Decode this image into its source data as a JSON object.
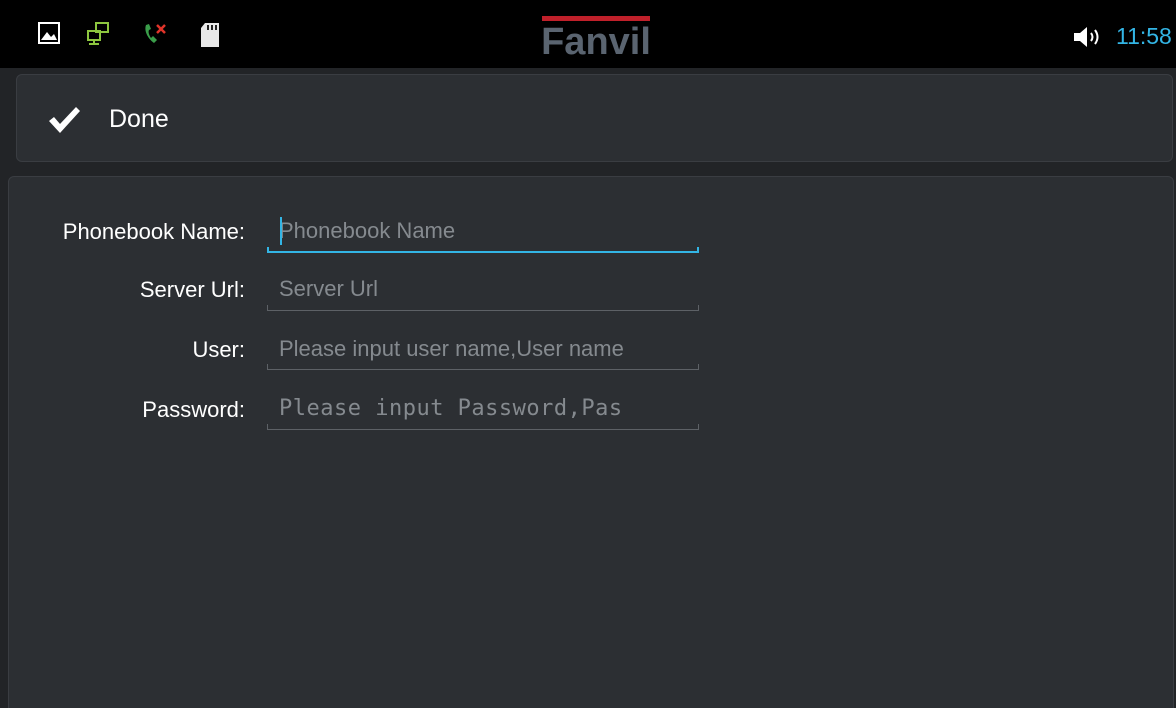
{
  "status_bar": {
    "icons": [
      "picture-icon",
      "network-icon",
      "missed-call-icon",
      "sd-card-icon"
    ],
    "brand": "Fanvil",
    "volume_icon": "volume-icon",
    "time": "11:58",
    "accent_color": "#33b5e5",
    "brand_color": "#c0202a"
  },
  "action_bar": {
    "done_icon": "checkmark-icon",
    "done_label": "Done"
  },
  "form": {
    "fields": [
      {
        "label": "Phonebook Name:",
        "value": "",
        "placeholder": "Phonebook Name",
        "focused": true
      },
      {
        "label": "Server Url:",
        "value": "",
        "placeholder": "Server Url",
        "focused": false
      },
      {
        "label": "User:",
        "value": "",
        "placeholder": "Please input user name,User name",
        "focused": false
      },
      {
        "label": "Password:",
        "value": "",
        "placeholder": "Please input Password,Pas",
        "focused": false
      }
    ]
  }
}
